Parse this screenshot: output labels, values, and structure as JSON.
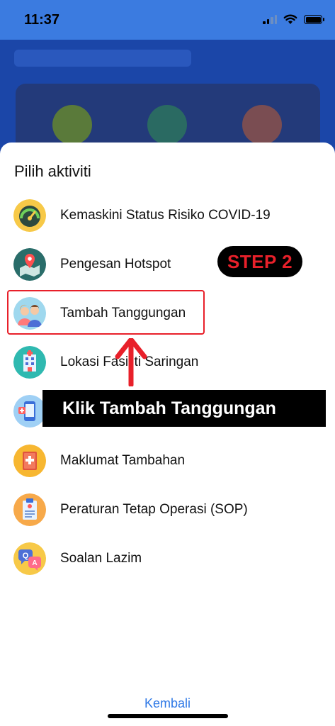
{
  "status_bar": {
    "time": "11:37"
  },
  "sheet": {
    "title": "Pilih aktiviti",
    "items": [
      {
        "label": "Kemaskini Status Risiko COVID-19",
        "icon": "risk-gauge-icon"
      },
      {
        "label": "Pengesan Hotspot",
        "icon": "map-pin-icon"
      },
      {
        "label": "Tambah Tanggungan",
        "icon": "family-icon"
      },
      {
        "label": "Lokasi Fasiliti Saringan",
        "icon": "hospital-icon"
      },
      {
        "label": "",
        "icon": "medical-phone-icon"
      },
      {
        "label": "Maklumat Tambahan",
        "icon": "first-aid-book-icon"
      },
      {
        "label": "Peraturan Tetap Operasi (SOP)",
        "icon": "clipboard-icon"
      },
      {
        "label": "Soalan Lazim",
        "icon": "faq-icon"
      }
    ],
    "back_label": "Kembali"
  },
  "annotations": {
    "step_badge": "STEP 2",
    "instruction": "Klik Tambah Tanggungan"
  },
  "colors": {
    "accent": "#2f79e6",
    "annotation_red": "#e8202a",
    "status_bar": "#3b7be0"
  }
}
